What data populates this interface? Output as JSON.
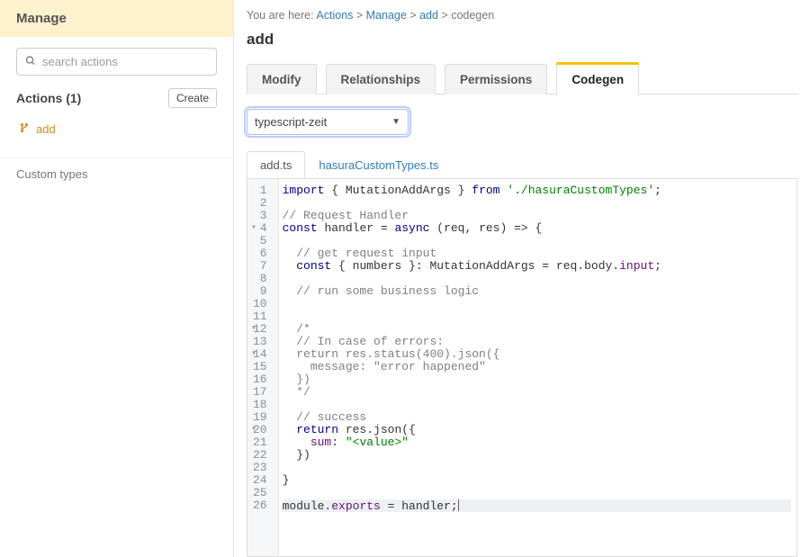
{
  "sidebar": {
    "header": "Manage",
    "search_placeholder": "search actions",
    "actions_heading": "Actions (1)",
    "create_label": "Create",
    "items": [
      {
        "name": "add"
      }
    ],
    "custom_types_label": "Custom types"
  },
  "breadcrumb": {
    "prefix": "You are here: ",
    "parts": [
      "Actions",
      "Manage",
      "add",
      "codegen"
    ]
  },
  "page_title": "add",
  "tabs": [
    {
      "label": "Modify",
      "active": false
    },
    {
      "label": "Relationships",
      "active": false
    },
    {
      "label": "Permissions",
      "active": false
    },
    {
      "label": "Codegen",
      "active": true
    }
  ],
  "framework_select": {
    "value": "typescript-zeit"
  },
  "file_tabs": [
    {
      "label": "add.ts",
      "active": true
    },
    {
      "label": "hasuraCustomTypes.ts",
      "active": false
    }
  ],
  "code": {
    "line_count": 26,
    "fold_lines": [
      4,
      12,
      14,
      20
    ],
    "highlight_line": 26,
    "lines_raw": [
      "import { MutationAddArgs } from './hasuraCustomTypes';",
      "",
      "// Request Handler",
      "const handler = async (req, res) => {",
      "",
      "  // get request input",
      "  const { numbers }: MutationAddArgs = req.body.input;",
      "",
      "  // run some business logic",
      "",
      "",
      "  /*",
      "  // In case of errors:",
      "  return res.status(400).json({",
      "    message: \"error happened\"",
      "  })",
      "  */",
      "",
      "  // success",
      "  return res.json({",
      "    sum: \"<value>\"",
      "  })",
      "",
      "}",
      "",
      "module.exports = handler;"
    ],
    "tokens": [
      [
        [
          "kw",
          "import"
        ],
        [
          "punc",
          " { "
        ],
        [
          "id",
          "MutationAddArgs"
        ],
        [
          "punc",
          " } "
        ],
        [
          "kw",
          "from"
        ],
        [
          "punc",
          " "
        ],
        [
          "str",
          "'./hasuraCustomTypes'"
        ],
        [
          "punc",
          ";"
        ]
      ],
      [],
      [
        [
          "cmt",
          "// Request Handler"
        ]
      ],
      [
        [
          "kw",
          "const"
        ],
        [
          "punc",
          " "
        ],
        [
          "id",
          "handler"
        ],
        [
          "punc",
          " = "
        ],
        [
          "kw",
          "async"
        ],
        [
          "punc",
          " (req, res) => {"
        ]
      ],
      [],
      [
        [
          "punc",
          "  "
        ],
        [
          "cmt",
          "// get request input"
        ]
      ],
      [
        [
          "punc",
          "  "
        ],
        [
          "kw",
          "const"
        ],
        [
          "punc",
          " { numbers }: "
        ],
        [
          "type",
          "MutationAddArgs"
        ],
        [
          "punc",
          " = req.body."
        ],
        [
          "prop",
          "input"
        ],
        [
          "punc",
          ";"
        ]
      ],
      [],
      [
        [
          "punc",
          "  "
        ],
        [
          "cmt",
          "// run some business logic"
        ]
      ],
      [],
      [],
      [
        [
          "punc",
          "  "
        ],
        [
          "cmt",
          "/*"
        ]
      ],
      [
        [
          "punc",
          "  "
        ],
        [
          "cmt",
          "// In case of errors:"
        ]
      ],
      [
        [
          "punc",
          "  "
        ],
        [
          "cmt",
          "return res.status(400).json({"
        ]
      ],
      [
        [
          "punc",
          "  "
        ],
        [
          "cmt",
          "  message: \"error happened\""
        ]
      ],
      [
        [
          "punc",
          "  "
        ],
        [
          "cmt",
          "})"
        ]
      ],
      [
        [
          "punc",
          "  "
        ],
        [
          "cmt",
          "*/"
        ]
      ],
      [],
      [
        [
          "punc",
          "  "
        ],
        [
          "cmt",
          "// success"
        ]
      ],
      [
        [
          "punc",
          "  "
        ],
        [
          "kw",
          "return"
        ],
        [
          "punc",
          " res."
        ],
        [
          "fn",
          "json"
        ],
        [
          "punc",
          "({"
        ]
      ],
      [
        [
          "punc",
          "    "
        ],
        [
          "prop",
          "sum"
        ],
        [
          "punc",
          ": "
        ],
        [
          "str",
          "\"<value>\""
        ]
      ],
      [
        [
          "punc",
          "  })"
        ]
      ],
      [],
      [
        [
          "punc",
          "}"
        ]
      ],
      [],
      [
        [
          "id",
          "module"
        ],
        [
          "punc",
          "."
        ],
        [
          "prop",
          "exports"
        ],
        [
          "punc",
          " = handler;"
        ]
      ]
    ]
  }
}
